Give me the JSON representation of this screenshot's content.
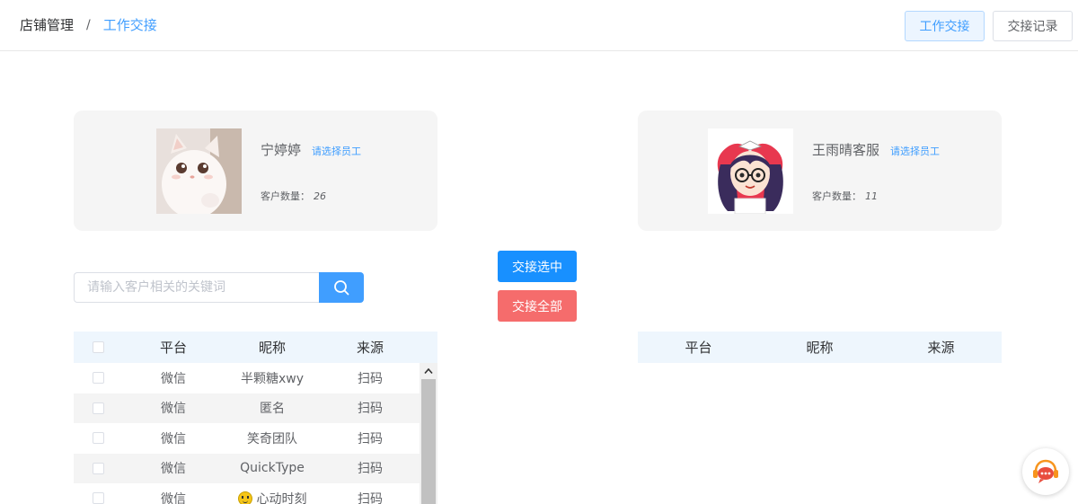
{
  "breadcrumb": {
    "root": "店铺管理",
    "separator": "/",
    "current": "工作交接"
  },
  "header_buttons": {
    "handover": "工作交接",
    "records": "交接记录"
  },
  "from_employee": {
    "name": "宁婷婷",
    "select_label": "请选择员工",
    "count_label": "客户数量：",
    "count": "26"
  },
  "to_employee": {
    "name": "王雨晴客服",
    "select_label": "请选择员工",
    "count_label": "客户数量：",
    "count": "11"
  },
  "search": {
    "placeholder": "请输入客户相关的关键词"
  },
  "actions": {
    "handover_selected": "交接选中",
    "handover_all": "交接全部"
  },
  "table": {
    "columns": [
      "平台",
      "昵称",
      "来源"
    ],
    "rows": [
      {
        "platform": "微信",
        "nickname": "半颗糖xwy",
        "source": "扫码"
      },
      {
        "platform": "微信",
        "nickname": "匿名",
        "source": "扫码"
      },
      {
        "platform": "微信",
        "nickname": "笑奇团队",
        "source": "扫码"
      },
      {
        "platform": "微信",
        "nickname": "QuickType",
        "source": "扫码"
      },
      {
        "platform": "微信",
        "nickname": "心动时刻",
        "source": "扫码"
      }
    ]
  },
  "icons": {
    "search": "search-icon",
    "chat": "customer-service-icon",
    "scroll_up": "chevron-up-icon"
  },
  "colors": {
    "primary": "#409eff",
    "button_blue": "#1890ff",
    "danger": "#f56c6c"
  }
}
